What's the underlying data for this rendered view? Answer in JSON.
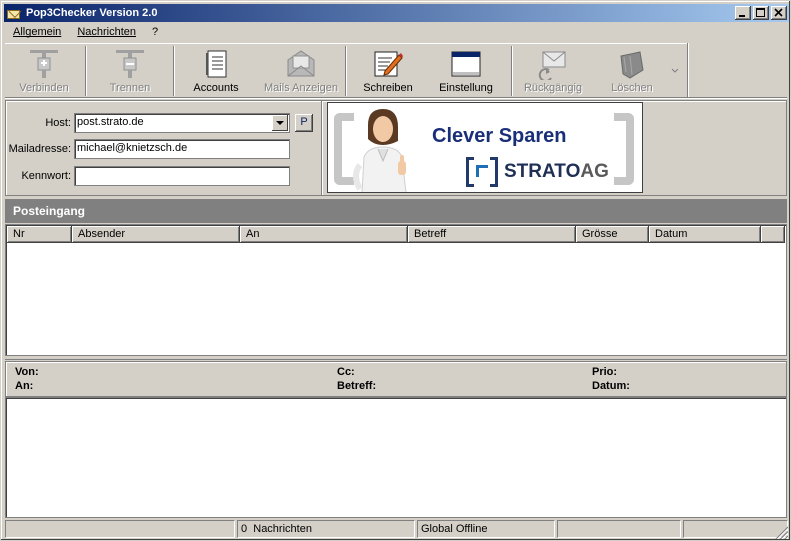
{
  "window": {
    "title": "Pop3Checker Version 2.0"
  },
  "menu": [
    {
      "label": "Allgemein"
    },
    {
      "label": "Nachrichten"
    },
    {
      "label": "?"
    }
  ],
  "toolbar": {
    "connect": "Verbinden",
    "disconnect": "Trennen",
    "accounts": "Accounts",
    "show_mails": "Mails Anzeigen",
    "write": "Schreiben",
    "settings": "Einstellung",
    "undo": "Rückgängig",
    "delete": "Löschen"
  },
  "account": {
    "host_label": "Host:",
    "host_value": "post.strato.de",
    "mail_label": "Mailadresse:",
    "mail_value": "michael@knietzsch.de",
    "password_label": "Kennwort:",
    "password_value": "",
    "p_button": "P"
  },
  "banner": {
    "slogan": "Clever Sparen",
    "brand": "STRATO",
    "brand_suffix": "AG"
  },
  "inbox": {
    "title": "Posteingang",
    "columns": [
      "Nr",
      "Absender",
      "An",
      "Betreff",
      "Grösse",
      "Datum"
    ]
  },
  "message_header": {
    "from": "Von:",
    "to": "An:",
    "cc": "Cc:",
    "subject": "Betreff:",
    "priority": "Prio:",
    "date": "Datum:"
  },
  "status": {
    "count": "0",
    "messages_label": "Nachrichten",
    "mode": "Global Offline"
  }
}
